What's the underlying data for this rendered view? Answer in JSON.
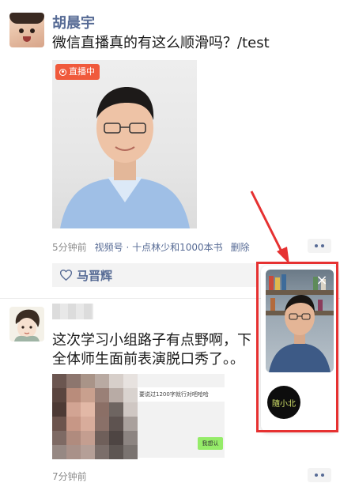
{
  "post1": {
    "author": "胡晨宇",
    "text": "微信直播真的有这么顺滑吗？/test",
    "live_badge": "直播中",
    "time": "5分钟前",
    "channel": "视频号 · 十点林少和1000本书",
    "delete_label": "删除",
    "liker": "马晋辉"
  },
  "post2": {
    "text_line1": "这次学习小组路子有点野啊，下",
    "text_line2": "全体师生面前表演脱口秀了。。",
    "screenshot_text": "要说过1200字就行对吧哈哈",
    "screenshot_bubble": "我想认",
    "time": "7分钟前"
  },
  "float_window": {
    "close_icon": "×",
    "logo_text": "隨小北"
  },
  "colors": {
    "link": "#576b95",
    "live_badge": "#f05a3c",
    "highlight_frame": "#e63131"
  }
}
